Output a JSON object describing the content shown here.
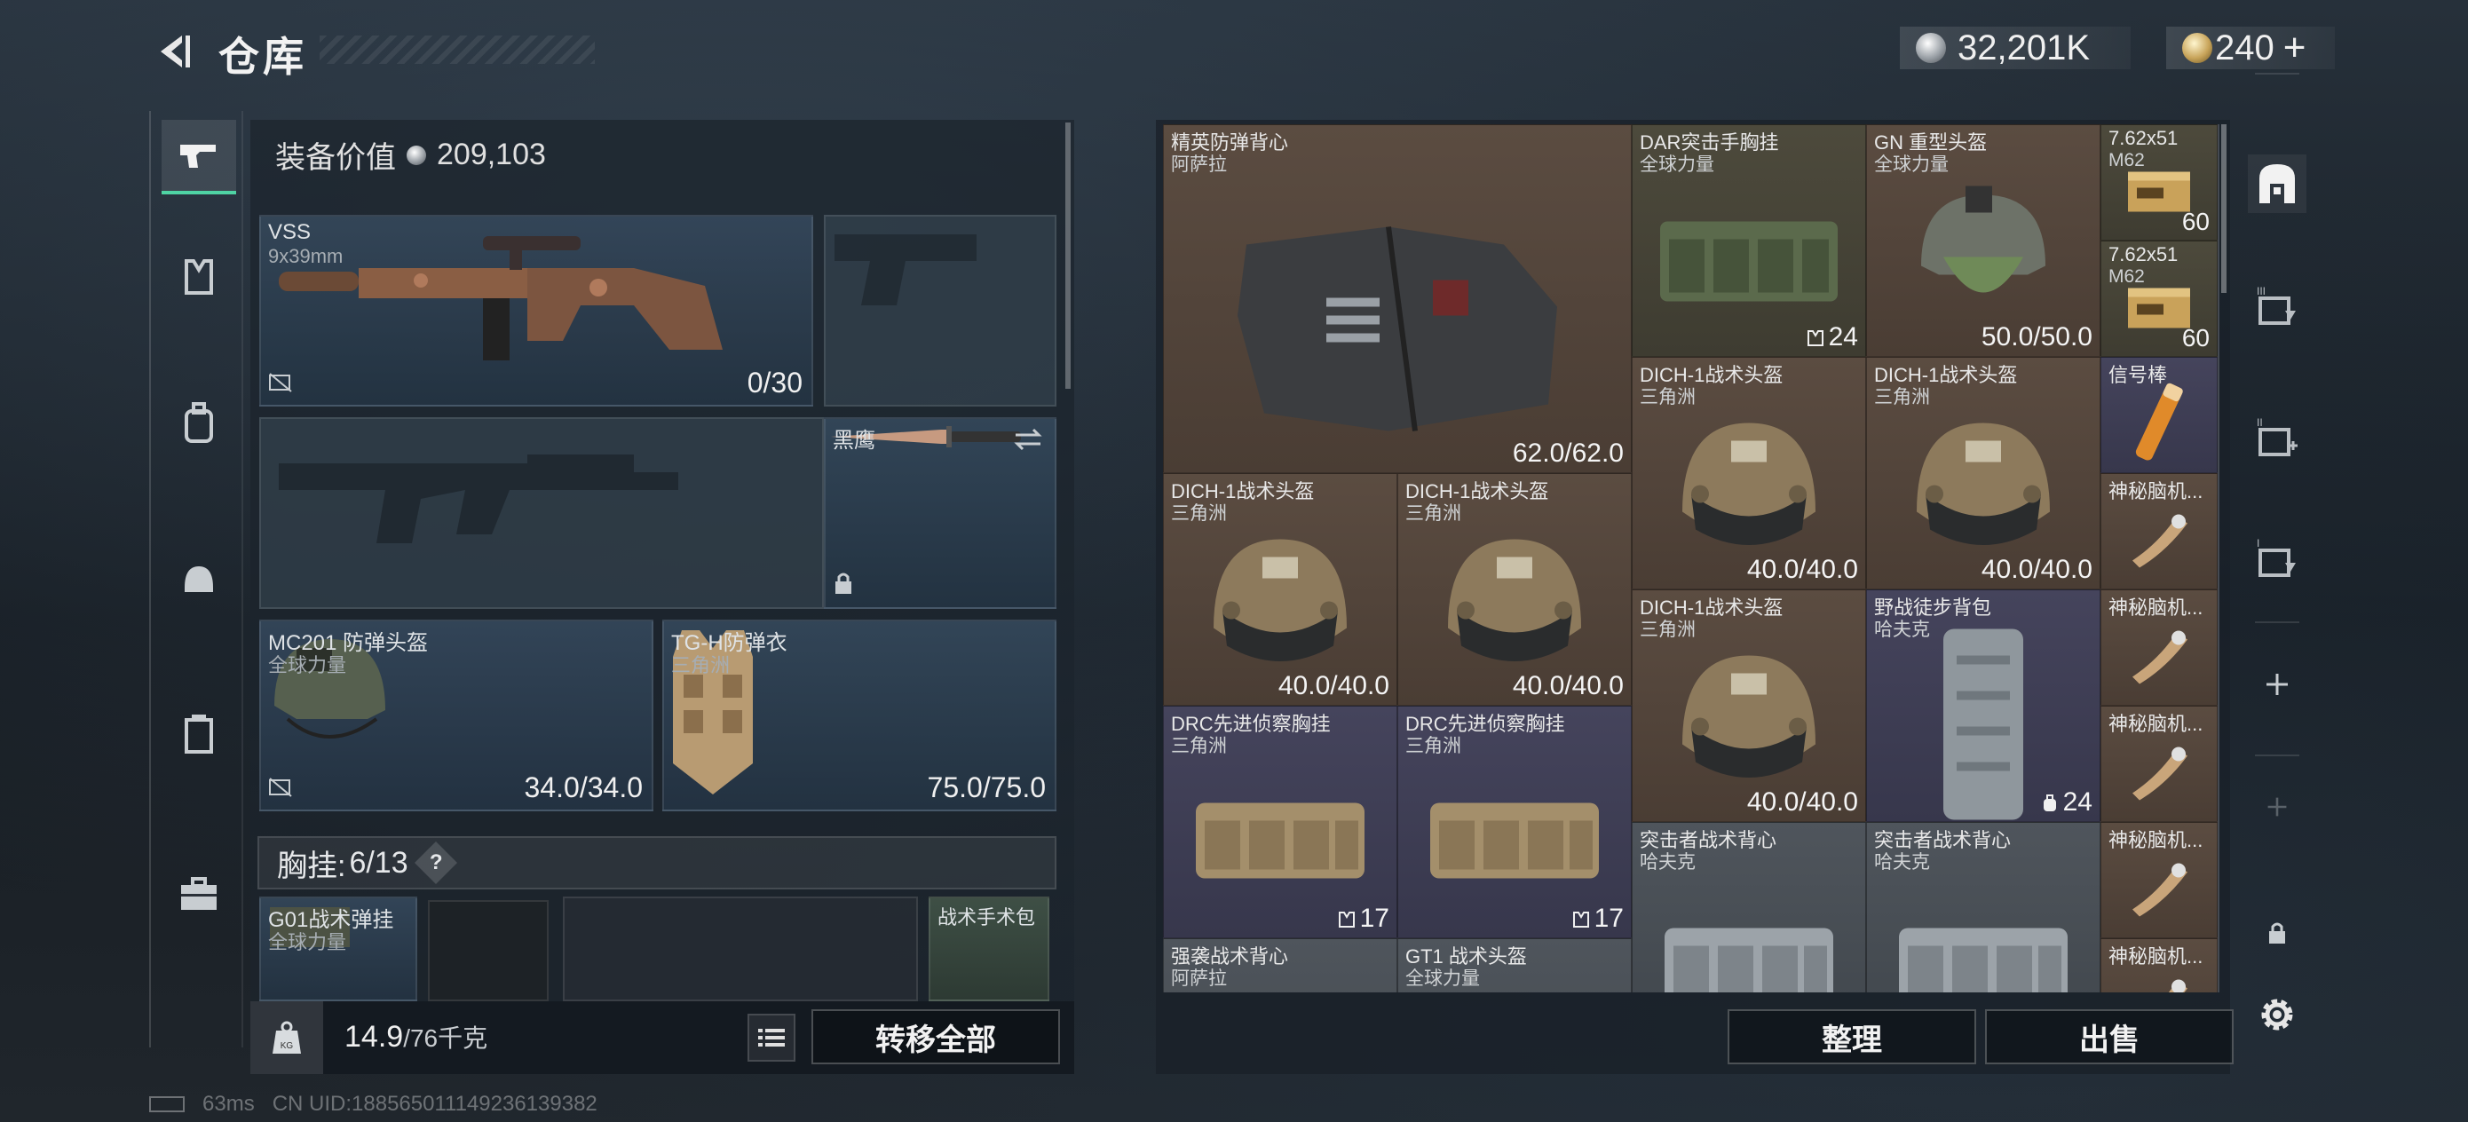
{
  "header": {
    "title": "仓库"
  },
  "currency": {
    "silver": "32,201K",
    "gold": "240",
    "add_symbol": "+"
  },
  "equipment": {
    "value_label": "装备价值",
    "value": "209,103",
    "primary": {
      "name": "VSS",
      "caliber": "9x39mm",
      "ammo": "0/30"
    },
    "knife": {
      "name": "黑鹰"
    },
    "helmet": {
      "name": "MC201 防弹头盔",
      "faction": "全球力量",
      "durability": "34.0/34.0"
    },
    "armor": {
      "name": "TG-H防弹衣",
      "faction": "三角洲",
      "durability": "75.0/75.0"
    },
    "rig": {
      "label": "胸挂:",
      "count": "6/13",
      "help": "?"
    },
    "rig_item": {
      "name": "G01战术弹挂",
      "faction": "全球力量"
    },
    "pouch": {
      "name": "战术手术包"
    },
    "weight": {
      "current": "14.9",
      "max": "/76千克"
    },
    "transfer_all": "转移全部"
  },
  "stash": {
    "items": [
      {
        "name": "精英防弹背心",
        "faction": "阿萨拉",
        "value": "62.0/62.0"
      },
      {
        "name": "DAR突击手胸挂",
        "faction": "全球力量",
        "value": "24"
      },
      {
        "name": "GN 重型头盔",
        "faction": "全球力量",
        "value": "50.0/50.0"
      },
      {
        "name": "7.62x51",
        "faction": "M62",
        "value": "60"
      },
      {
        "name": "7.62x51",
        "faction": "M62",
        "value": "60"
      },
      {
        "name": "DICH-1战术头盔",
        "faction": "三角洲",
        "value": "40.0/40.0"
      },
      {
        "name": "DICH-1战术头盔",
        "faction": "三角洲",
        "value": "40.0/40.0"
      },
      {
        "name": "信号棒",
        "faction": "",
        "value": ""
      },
      {
        "name": "DICH-1战术头盔",
        "faction": "三角洲",
        "value": "40.0/40.0"
      },
      {
        "name": "DICH-1战术头盔",
        "faction": "三角洲",
        "value": "40.0/40.0"
      },
      {
        "name": "神秘脑机...",
        "faction": "",
        "value": ""
      },
      {
        "name": "DICH-1战术头盔",
        "faction": "三角洲",
        "value": "40.0/40.0"
      },
      {
        "name": "野战徒步背包",
        "faction": "哈夫克",
        "value": "24"
      },
      {
        "name": "神秘脑机...",
        "faction": "",
        "value": ""
      },
      {
        "name": "DRC先进侦察胸挂",
        "faction": "三角洲",
        "value": "17"
      },
      {
        "name": "DRC先进侦察胸挂",
        "faction": "三角洲",
        "value": "17"
      },
      {
        "name": "神秘脑机...",
        "faction": "",
        "value": ""
      },
      {
        "name": "突击者战术背心",
        "faction": "哈夫克",
        "value": ""
      },
      {
        "name": "突击者战术背心",
        "faction": "哈夫克",
        "value": ""
      },
      {
        "name": "神秘脑机...",
        "faction": "",
        "value": ""
      },
      {
        "name": "强袭战术背心",
        "faction": "阿萨拉",
        "value": ""
      },
      {
        "name": "GT1 战术头盔",
        "faction": "全球力量",
        "value": ""
      },
      {
        "name": "神秘脑机...",
        "faction": "",
        "value": ""
      }
    ],
    "sort_button": "整理",
    "sell_button": "出售"
  },
  "status": {
    "ping": "63ms",
    "uid": "CN UID:1885650111492361393​82"
  },
  "colors": {
    "accent": "#4fd3a4",
    "cell_brown": "#5b4c41",
    "cell_purple": "#45445c",
    "cell_olive": "#4d4a3c"
  },
  "icons": [
    "back-arrow-icon",
    "weapon-icon",
    "vest-icon",
    "backpack-icon",
    "helmet-icon",
    "rig-icon",
    "case-icon",
    "safebox-icon",
    "stash-1-icon",
    "stash-2-icon",
    "stash-3-icon",
    "plus-icon",
    "lock-icon",
    "gear-icon",
    "swap-icon",
    "list-icon",
    "weight-icon"
  ]
}
